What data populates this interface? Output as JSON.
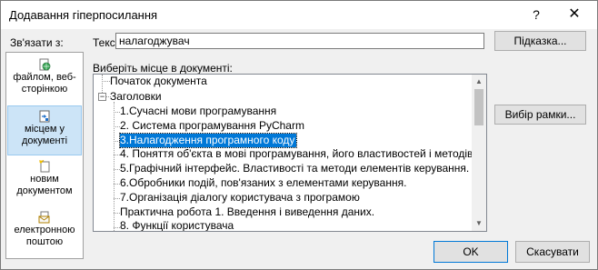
{
  "window": {
    "title": "Додавання гіперпосилання",
    "help_glyph": "?",
    "close_glyph": "✕"
  },
  "link_to": {
    "label": "Зв'язати з:",
    "items": [
      {
        "label": "файлом, веб-сторінкою",
        "icon": "web-page-file-icon",
        "selected": false
      },
      {
        "label": "місцем у документі",
        "icon": "place-in-document-icon",
        "selected": true
      },
      {
        "label": "новим документом",
        "icon": "new-document-icon",
        "selected": false
      },
      {
        "label": "електронною поштою",
        "icon": "email-icon",
        "selected": false
      }
    ]
  },
  "text_field": {
    "label": "Текст:",
    "value": "налагоджувач"
  },
  "buttons": {
    "tip": "Підказка...",
    "frame": "Вибір рамки...",
    "ok": "OK",
    "cancel": "Скасувати"
  },
  "place": {
    "label": "Виберіть місце в документі:",
    "top_item": "Початок документа",
    "headings_label": "Заголовки",
    "headings_toggle": "−",
    "headings": [
      "1.Сучасні мови програмування",
      "2. Система програмування PyCharm",
      "3.Налагодження програмного коду",
      "4. Поняття об'єкта в мові програмування, його властивостей і методів.",
      "5.Графічний інтерфейс. Властивості та методи елементів керування.",
      "6.Обробники подій, пов'язаних з елементами керування.",
      "7.Організація діалогу користувача з програмою",
      "Практична робота 1.    Введення і виведення даних.",
      "8.  Функції користувача"
    ],
    "selected_index": 2
  },
  "scrollbar": {
    "up_glyph": "▲",
    "down_glyph": "▼"
  },
  "colors": {
    "selection": "#0078d7",
    "link_selected_bg": "#cce4f7"
  }
}
